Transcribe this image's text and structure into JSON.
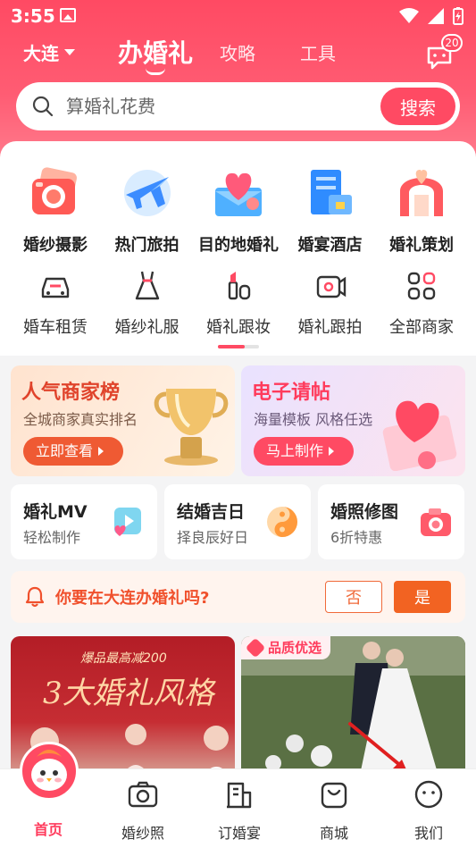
{
  "status_bar": {
    "time": "3:55"
  },
  "header": {
    "city": "大连",
    "tabs": [
      {
        "label": "办婚礼",
        "active": true
      },
      {
        "label": "攻略",
        "active": false
      },
      {
        "label": "工具",
        "active": false
      }
    ],
    "message_badge": "20"
  },
  "search": {
    "placeholder": "算婚礼花费",
    "button_label": "搜索"
  },
  "categories_primary": [
    {
      "label": "婚纱摄影",
      "icon": "camera-icon"
    },
    {
      "label": "热门旅拍",
      "icon": "plane-icon"
    },
    {
      "label": "目的地婚礼",
      "icon": "heart-envelope-icon"
    },
    {
      "label": "婚宴酒店",
      "icon": "hotel-icon"
    },
    {
      "label": "婚礼策划",
      "icon": "arch-icon"
    }
  ],
  "categories_secondary": [
    {
      "label": "婚车租赁",
      "icon": "car-icon"
    },
    {
      "label": "婚纱礼服",
      "icon": "dress-icon"
    },
    {
      "label": "婚礼跟妆",
      "icon": "makeup-icon"
    },
    {
      "label": "婚礼跟拍",
      "icon": "video-camera-icon"
    },
    {
      "label": "全部商家",
      "icon": "grid-icon"
    }
  ],
  "banners": [
    {
      "title": "人气商家榜",
      "subtitle": "全城商家真实排名",
      "button": "立即查看"
    },
    {
      "title": "电子请帖",
      "subtitle": "海量模板 风格任选",
      "button": "马上制作"
    }
  ],
  "mini_cards": [
    {
      "title": "婚礼MV",
      "subtitle": "轻松制作"
    },
    {
      "title": "结婚吉日",
      "subtitle": "择良辰好日"
    },
    {
      "title": "婚照修图",
      "subtitle": "6折特惠"
    }
  ],
  "city_prompt": {
    "text": "你要在大连办婚礼吗?",
    "no": "否",
    "yes": "是"
  },
  "feed": [
    {
      "promo": "爆品最高减200",
      "title": "3大婚礼风格"
    },
    {
      "badge": "品质优选"
    }
  ],
  "tabbar": [
    {
      "label": "首页",
      "icon": "home-mascot-icon",
      "active": true
    },
    {
      "label": "婚纱照",
      "icon": "camera-icon",
      "active": false
    },
    {
      "label": "订婚宴",
      "icon": "building-icon",
      "active": false
    },
    {
      "label": "商城",
      "icon": "bag-icon",
      "active": false
    },
    {
      "label": "我们",
      "icon": "smile-icon",
      "active": false
    }
  ],
  "colors": {
    "brand": "#ff4a63",
    "orange": "#f26322"
  }
}
